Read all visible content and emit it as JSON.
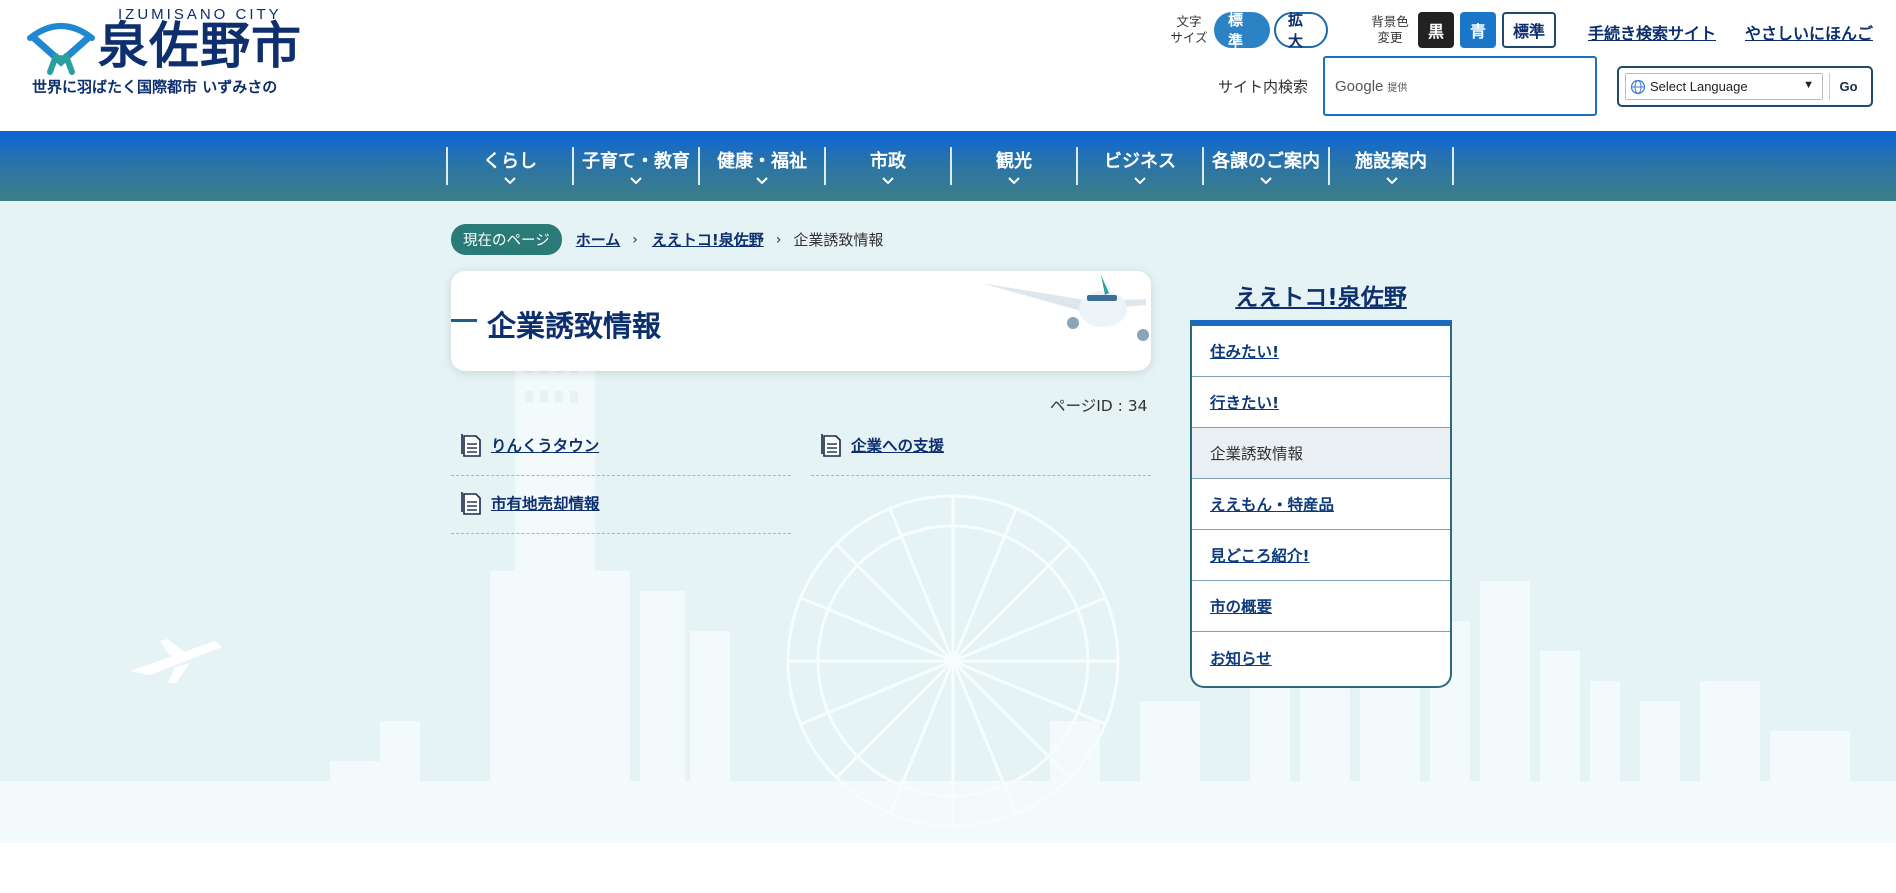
{
  "site": {
    "name_en": "IZUMISANO CITY",
    "name_ja": "泉佐野市",
    "tagline": "世界に羽ばたく国際都市 いずみさの"
  },
  "utility": {
    "text_size_label": "文字\nサイズ",
    "text_size_standard": "標準",
    "text_size_large": "拡大",
    "bg_label": "背景色\n変更",
    "bg_black": "黒",
    "bg_blue": "青",
    "bg_standard": "標準",
    "procedures_link": "手続き検索サイト",
    "easy_japanese_link": "やさしいにほんご"
  },
  "search": {
    "label": "サイト内検索",
    "provider": "Google",
    "provider_note": "提供"
  },
  "language": {
    "selected": "Select Language",
    "go": "Go"
  },
  "nav": {
    "items": [
      "くらし",
      "子育て・教育",
      "健康・福祉",
      "市政",
      "観光",
      "ビジネス",
      "各課のご案内",
      "施設案内"
    ]
  },
  "breadcrumb": {
    "current_label": "現在のページ",
    "home": "ホーム",
    "parent": "ええトコ!泉佐野",
    "current": "企業誘致情報",
    "separator": "›"
  },
  "page": {
    "title": "企業誘致情報",
    "page_id": "ページID : 34",
    "links": [
      "りんくうタウン",
      "企業への支援",
      "市有地売却情報"
    ]
  },
  "side": {
    "title": "ええトコ!泉佐野",
    "items": [
      {
        "label": "住みたい!",
        "current": false
      },
      {
        "label": "行きたい!",
        "current": false
      },
      {
        "label": "企業誘致情報",
        "current": true
      },
      {
        "label": "ええもん・特産品",
        "current": false
      },
      {
        "label": "見どころ紹介!",
        "current": false
      },
      {
        "label": "市の概要",
        "current": false
      },
      {
        "label": "お知らせ",
        "current": false
      }
    ]
  },
  "colors": {
    "brand_navy": "#0d2f6e",
    "nav_top": "#0a66d8",
    "nav_bottom": "#3d7f88",
    "background": "#e5f3f5",
    "accent_teal": "#2a7a78"
  }
}
